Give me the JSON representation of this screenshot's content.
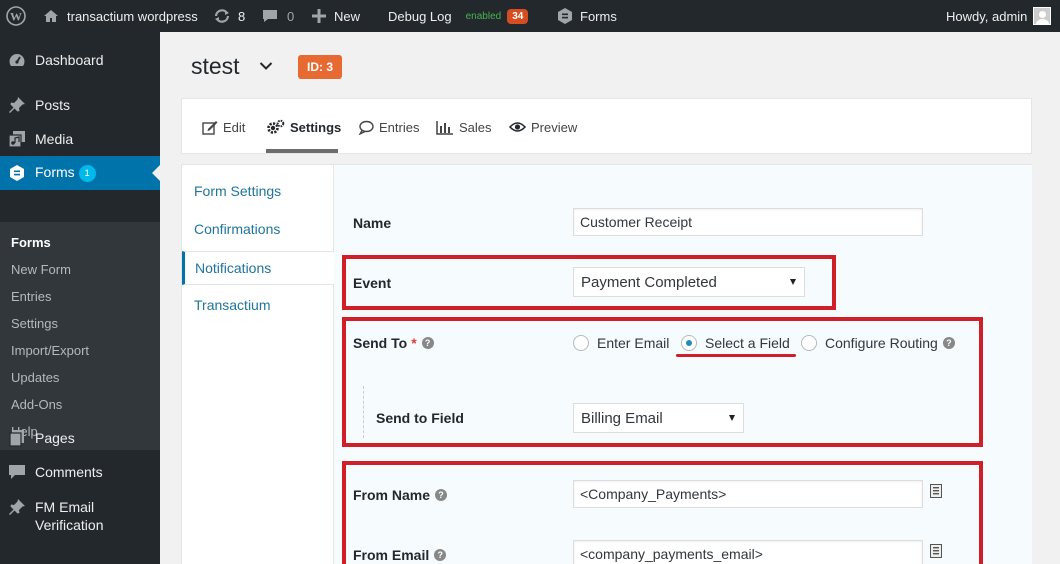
{
  "adminbar": {
    "site_name": "transactium wordpress",
    "updates_count": "8",
    "comments_count": "0",
    "new_label": "New",
    "debug_label": "Debug Log",
    "debug_status": "enabled",
    "debug_count": "34",
    "forms_label": "Forms",
    "howdy": "Howdy, admin"
  },
  "sidebar": {
    "dashboard": "Dashboard",
    "posts": "Posts",
    "media": "Media",
    "forms": "Forms",
    "forms_badge": "1",
    "submenu": [
      "Forms",
      "New Form",
      "Entries",
      "Settings",
      "Import/Export",
      "Updates",
      "Add-Ons",
      "Help"
    ],
    "pages": "Pages",
    "comments": "Comments",
    "fm_line1": "FM Email",
    "fm_line2": "Verification"
  },
  "page": {
    "title": "stest",
    "id_badge": "ID: 3"
  },
  "toolbar": {
    "edit": "Edit",
    "settings": "Settings",
    "entries": "Entries",
    "sales": "Sales",
    "preview": "Preview"
  },
  "settings_nav": [
    "Form Settings",
    "Confirmations",
    "Notifications",
    "Transactium"
  ],
  "form": {
    "name_label": "Name",
    "name_value": "Customer Receipt",
    "event_label": "Event",
    "event_value": "Payment Completed",
    "sendto_label": "Send To",
    "sendto_required": "*",
    "radio_enter_email": "Enter Email",
    "radio_select_field": "Select a Field",
    "radio_routing": "Configure Routing",
    "sendfield_label": "Send to Field",
    "sendfield_value": "Billing Email",
    "fromname_label": "From Name",
    "fromname_value": "<Company_Payments>",
    "fromemail_label": "From Email",
    "fromemail_value": "<company_payments_email>",
    "help_glyph": "?"
  },
  "colors": {
    "adminbar_bg": "#23282d",
    "menu_current": "#0073aa",
    "id_badge": "#e66a32",
    "highlight_red": "#d11f29"
  }
}
